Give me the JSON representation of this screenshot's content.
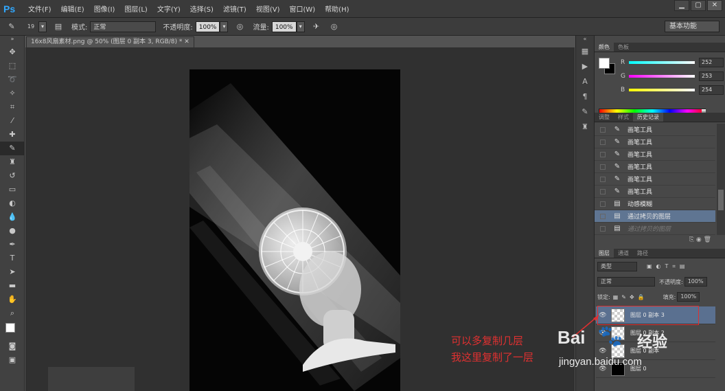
{
  "app": {
    "logo": "Ps",
    "menu": [
      "文件(F)",
      "编辑(E)",
      "图像(I)",
      "图层(L)",
      "文字(Y)",
      "选择(S)",
      "滤镜(T)",
      "视图(V)",
      "窗口(W)",
      "帮助(H)"
    ]
  },
  "options": {
    "brush_size": "19",
    "mode_label": "模式:",
    "mode_value": "正常",
    "opacity_label": "不透明度:",
    "opacity_value": "100%",
    "flow_label": "流量:",
    "flow_value": "100%",
    "workspace": "基本功能"
  },
  "document": {
    "tab_title": "16x8风扇素材.png @ 50% (图层 0 副本 3, RGB/8) * "
  },
  "color_panel": {
    "tabs": [
      "颜色",
      "色板"
    ],
    "r_label": "R",
    "r_value": "252",
    "g_label": "G",
    "g_value": "253",
    "b_label": "B",
    "b_value": "254"
  },
  "history_panel": {
    "tabs": [
      "调整",
      "样式",
      "历史记录"
    ],
    "items": [
      {
        "label": "画笔工具",
        "icon": "brush-icon"
      },
      {
        "label": "画笔工具",
        "icon": "brush-icon"
      },
      {
        "label": "画笔工具",
        "icon": "brush-icon"
      },
      {
        "label": "画笔工具",
        "icon": "brush-icon"
      },
      {
        "label": "画笔工具",
        "icon": "brush-icon"
      },
      {
        "label": "画笔工具",
        "icon": "brush-icon"
      },
      {
        "label": "动感模糊",
        "icon": "document-icon"
      },
      {
        "label": "通过拷贝的图层",
        "icon": "document-icon"
      },
      {
        "label": "通过拷贝的图层",
        "icon": "document-icon"
      }
    ]
  },
  "layers_panel": {
    "tabs": [
      "图层",
      "通道",
      "路径"
    ],
    "filter_value": "类型",
    "blend_mode": "正常",
    "opacity_label": "不透明度:",
    "opacity_value": "100%",
    "lock_label": "锁定:",
    "fill_label": "填充:",
    "fill_value": "100%",
    "layers": [
      {
        "name": "图层 0 副本 3",
        "thumb": "checker"
      },
      {
        "name": "图层 0 副本 2",
        "thumb": "checker"
      },
      {
        "name": "图层 0 副本",
        "thumb": "checker"
      },
      {
        "name": "图层 0",
        "thumb": "black"
      }
    ]
  },
  "annotation": {
    "line1": "可以多复制几层",
    "line2": "我这里复制了一层"
  },
  "watermark": {
    "logo": "Bai",
    "cn": "经验",
    "url": "jingyan.baidu.com"
  }
}
